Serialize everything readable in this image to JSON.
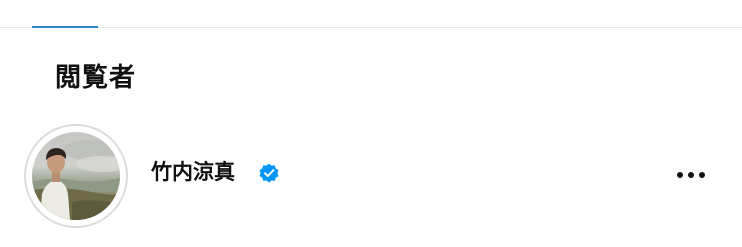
{
  "section": {
    "title": "閲覧者"
  },
  "viewer": {
    "username": "竹内涼真",
    "verified": true,
    "avatar_icon": "profile-photo",
    "more_icon": "more-horizontal-icon"
  },
  "colors": {
    "tab_indicator": "#2a86c4",
    "verified_badge": "#0095f6",
    "text": "#111111",
    "divider": "#e6e6e6"
  }
}
